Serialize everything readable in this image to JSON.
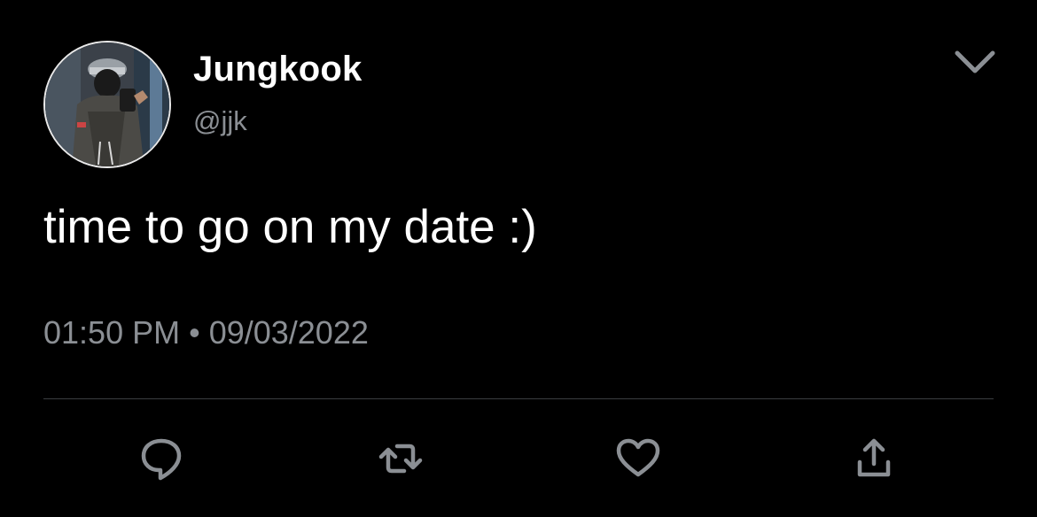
{
  "author": {
    "display_name": "Jungkook",
    "handle": "@jjk",
    "avatar_icon": "profile-photo"
  },
  "tweet": {
    "text": "time to go on my date :)",
    "time": "01:50 PM",
    "separator": "•",
    "date": "09/03/2022",
    "timestamp": "01:50 PM • 09/03/2022"
  },
  "actions": {
    "reply_icon": "reply-icon",
    "retweet_icon": "retweet-icon",
    "like_icon": "heart-icon",
    "share_icon": "share-icon"
  },
  "menu": {
    "icon": "chevron-down-icon"
  },
  "colors": {
    "background": "#000000",
    "primary_text": "#ffffff",
    "secondary_text": "#8b8f94",
    "divider": "#3a3d40",
    "icon": "#8b8f94"
  }
}
